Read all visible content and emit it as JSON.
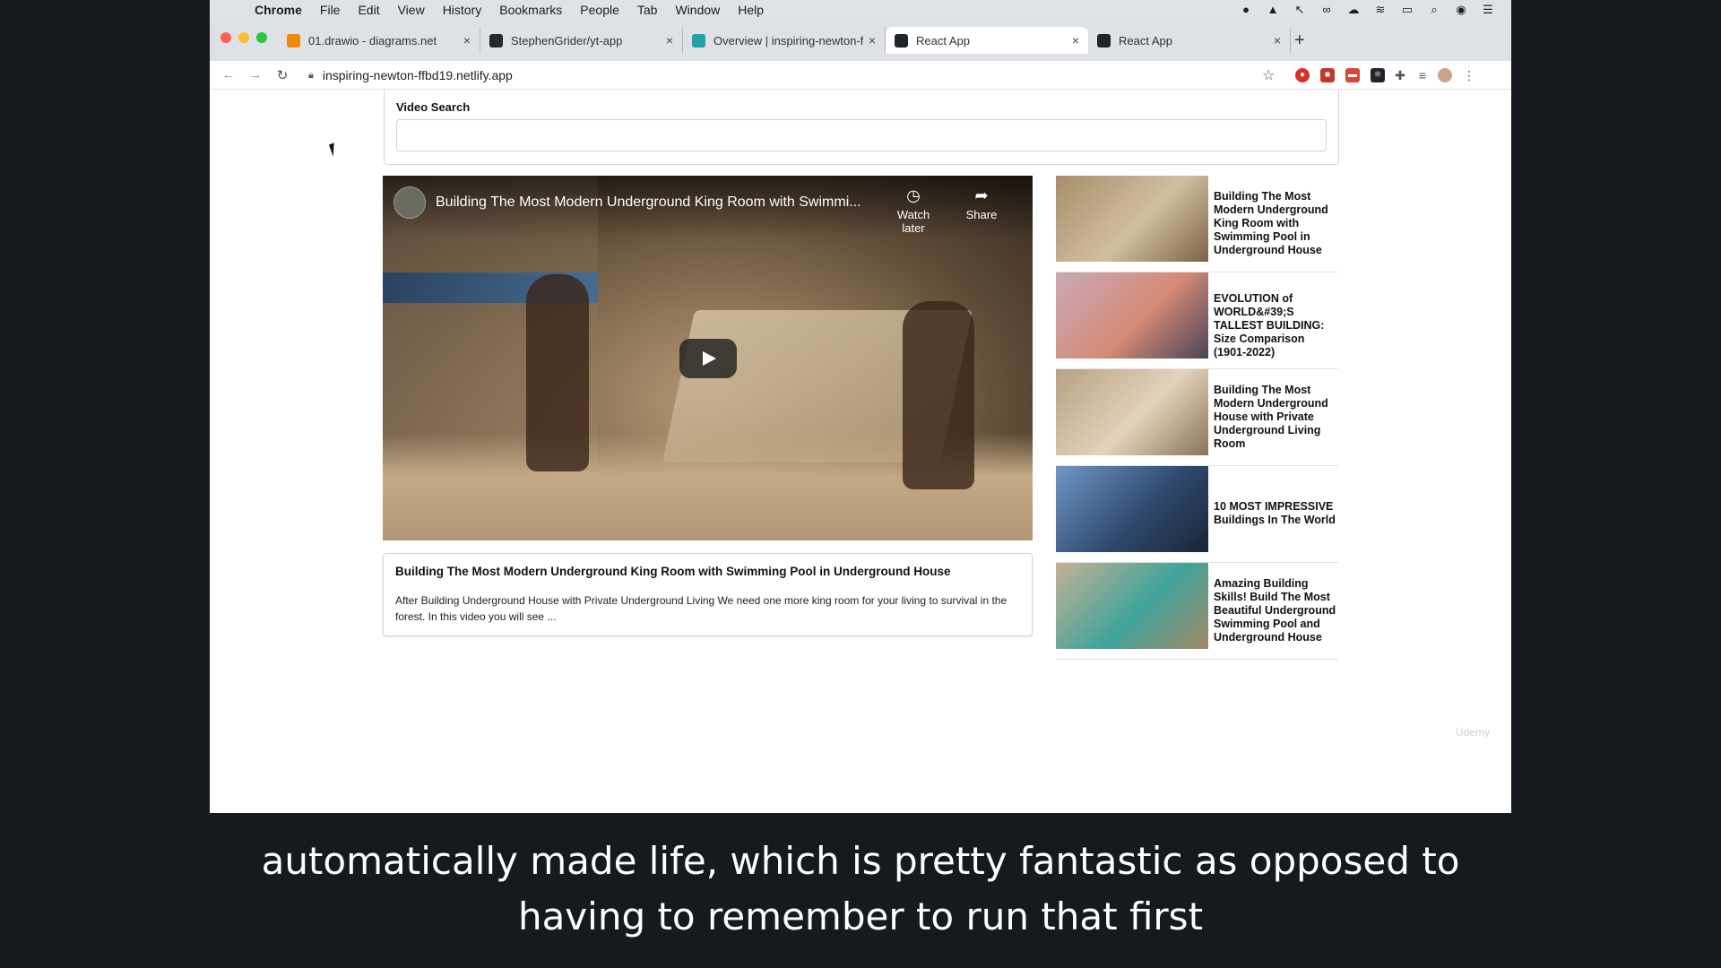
{
  "menubar": {
    "app": "Chrome",
    "items": [
      "File",
      "Edit",
      "View",
      "History",
      "Bookmarks",
      "People",
      "Tab",
      "Window",
      "Help"
    ]
  },
  "tabs": [
    {
      "title": "01.drawio - diagrams.net",
      "favicon_color": "#f08705",
      "active": false
    },
    {
      "title": "StephenGrider/yt-app",
      "favicon_color": "#24292e",
      "active": false
    },
    {
      "title": "Overview | inspiring-newton-ff",
      "favicon_color": "#20a2a8",
      "active": false
    },
    {
      "title": "React App",
      "favicon_color": "#20232a",
      "active": true
    },
    {
      "title": "React App",
      "favicon_color": "#20232a",
      "active": false
    }
  ],
  "address_bar": {
    "url": "inspiring-newton-ffbd19.netlify.app"
  },
  "search": {
    "label": "Video Search",
    "value": ""
  },
  "player": {
    "title": "Building The Most Modern Underground King Room with Swimmi...",
    "watch_later": "Watch later",
    "share": "Share"
  },
  "detail": {
    "title": "Building The Most Modern Underground King Room with Swimming Pool in Underground House",
    "description": "After Building Underground House with Private Underground Living We need one more king room for your living to survival in the forest. In this video you will see ..."
  },
  "videos": [
    {
      "title": "Building The Most Modern Underground King Room with Swimming Pool in Underground House",
      "thumb": [
        "#a88d6c",
        "#d2bf9f",
        "#7c6248"
      ]
    },
    {
      "title": "EVOLUTION of WORLD&#39;S TALLEST BUILDING: Size Comparison (1901-2022)",
      "thumb": [
        "#c9aab6",
        "#d58a76",
        "#4a4356"
      ]
    },
    {
      "title": "Building The Most Modern Underground House with Private Underground Living Room",
      "thumb": [
        "#b8a183",
        "#e3d3bb",
        "#8a7256"
      ]
    },
    {
      "title": "10 MOST IMPRESSIVE Buildings In The World",
      "thumb": [
        "#6f97c6",
        "#2f4a6f",
        "#1b2534"
      ]
    },
    {
      "title": "Amazing Building Skills! Build The Most Beautiful Underground Swimming Pool and Underground House",
      "thumb": [
        "#c6b292",
        "#3fa39c",
        "#a48966"
      ]
    }
  ],
  "watermark": "Udemy",
  "caption": {
    "line1": "automatically made life, which is pretty fantastic as opposed to",
    "line2": "having to remember to run that first"
  }
}
